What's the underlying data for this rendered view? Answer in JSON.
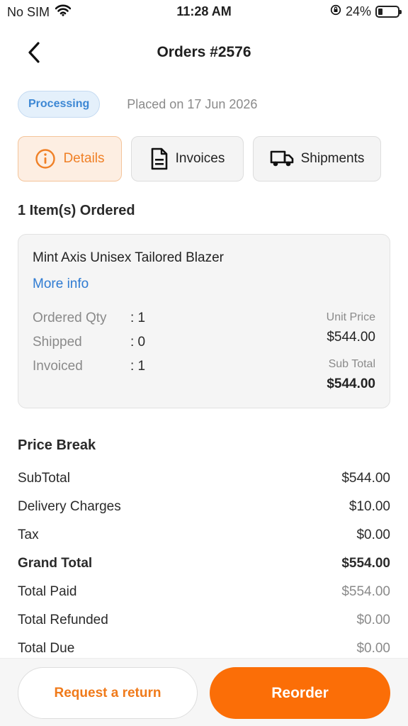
{
  "status_bar": {
    "carrier": "No SIM",
    "time": "11:28 AM",
    "battery": "24%",
    "icons": [
      "wifi-icon",
      "orientation-lock-icon",
      "battery-icon"
    ]
  },
  "header": {
    "title": "Orders #2576",
    "back_icon": "chevron-left-icon"
  },
  "order": {
    "status": "Processing",
    "placed": "Placed on 17 Jun 2026"
  },
  "tabs": [
    {
      "label": "Details",
      "icon": "info-icon",
      "active": true
    },
    {
      "label": "Invoices",
      "icon": "document-icon",
      "active": false
    },
    {
      "label": "Shipments",
      "icon": "truck-icon",
      "active": false
    }
  ],
  "items_title": "1 Item(s) Ordered",
  "item": {
    "name": "Mint Axis Unisex Tailored Blazer",
    "more_info": "More info",
    "ordered_label": "Ordered Qty",
    "ordered_value": ": 1",
    "shipped_label": "Shipped",
    "shipped_value": ": 0",
    "invoiced_label": "Invoiced",
    "invoiced_value": ": 1",
    "unit_price_label": "Unit Price",
    "unit_price": "$544.00",
    "sub_total_label": "Sub Total",
    "sub_total": "$544.00"
  },
  "breakdown": {
    "title": "Price Break",
    "rows": [
      {
        "label": "SubTotal",
        "value": "$544.00"
      },
      {
        "label": "Delivery Charges",
        "value": "$10.00"
      },
      {
        "label": "Tax",
        "value": "$0.00"
      },
      {
        "label": "Grand Total",
        "value": "$554.00"
      },
      {
        "label": "Total Paid",
        "value": "$554.00"
      },
      {
        "label": "Total Refunded",
        "value": "$0.00"
      },
      {
        "label": "Total Due",
        "value": "$0.00"
      }
    ]
  },
  "actions": {
    "return_label": "Request a return",
    "reorder_label": "Reorder"
  },
  "colors": {
    "accent": "#fb6e07",
    "link": "#2f7bd2",
    "status_badge_bg": "#e4f0fb",
    "status_badge_text": "#3c87d4"
  }
}
